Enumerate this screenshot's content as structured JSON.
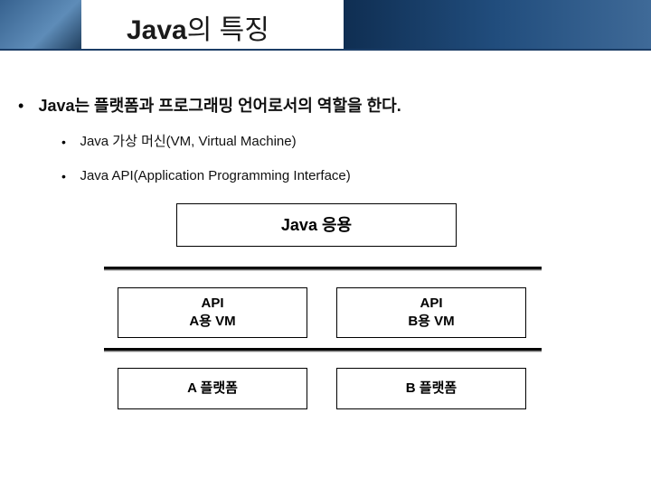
{
  "title": {
    "part1": "Java",
    "part2": "의 특징"
  },
  "bullets": {
    "lvl1": "Java는 플랫폼과 프로그래밍 언어로서의 역할을 한다.",
    "lvl2a": "Java 가상 머신(VM, Virtual Machine)",
    "lvl2b": "Java API(Application Programming Interface)"
  },
  "diagram": {
    "top": "Java 응용",
    "a1_line1": "API",
    "a1_line2": "A용 VM",
    "b1_line1": "API",
    "b1_line2": "B용 VM",
    "a2": "A 플랫폼",
    "b2": "B 플랫폼"
  }
}
